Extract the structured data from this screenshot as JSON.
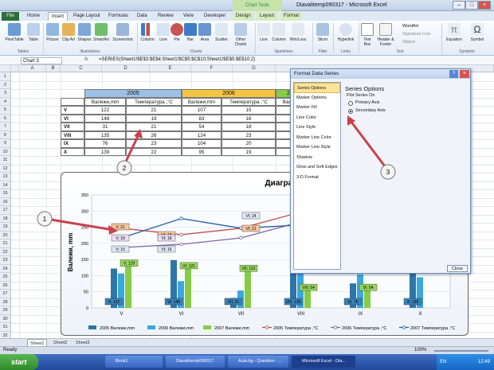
{
  "window": {
    "title": "Diavalitemp090317 - Microsoft Excel",
    "contextual_group": "Chart Tools"
  },
  "tabs": [
    "File",
    "Home",
    "Insert",
    "Page Layout",
    "Formulas",
    "Data",
    "Review",
    "View",
    "Developer",
    "Design",
    "Layout",
    "Format"
  ],
  "ribbon": {
    "buttons": [
      "PivotTable",
      "Table",
      "Picture",
      "Clip Art",
      "Shapes",
      "SmartArt",
      "Screenshot",
      "Column",
      "Line",
      "Pie",
      "Bar",
      "Area",
      "Scatter",
      "Other Charts",
      "Line",
      "Column",
      "Win/Loss",
      "Slicer",
      "Hyperlink",
      "Text Box",
      "Header & Footer",
      "Equation",
      "Symbol"
    ],
    "small": [
      "WordArt",
      "Signature Line",
      "Object"
    ],
    "groups": [
      "Tables",
      "Illustrations",
      "Charts",
      "Sparklines",
      "Filter",
      "Links",
      "Text",
      "Symbols"
    ]
  },
  "formula_bar": {
    "name_box": "Chart 3",
    "fx": "fx",
    "formula": "=SERIES(Sheet1!$E$3:$E$4;Sheet1!$C$5:$C$10;Sheet1!$E$5:$E$10;2)"
  },
  "columns": [
    "A",
    "B",
    "C",
    "D",
    "E",
    "F",
    "G"
  ],
  "rows": [
    "1",
    "2",
    "3",
    "4",
    "5",
    "6",
    "7",
    "8",
    "9",
    "10",
    "11",
    "12",
    "13",
    "14",
    "15",
    "16",
    "17",
    "18",
    "19",
    "20",
    "21",
    "22",
    "23",
    "24",
    "25",
    "26",
    "27",
    "28",
    "29",
    "30",
    "31",
    "32"
  ],
  "table": {
    "years": [
      "2005",
      "2006",
      "2"
    ],
    "headers": [
      "Валежи,mm",
      "Температура ,°C",
      "Валежи,mm",
      "Температура ,°C",
      "Вале"
    ],
    "rows": [
      {
        "month": "V",
        "v1": "122",
        "t1": "21",
        "v2": "107",
        "t2": "15"
      },
      {
        "month": "VI",
        "v1": "148",
        "t1": "19",
        "v2": "83",
        "t2": "16"
      },
      {
        "month": "VII",
        "v1": "31",
        "t1": "21",
        "v2": "54",
        "t2": "18"
      },
      {
        "month": "VIII",
        "v1": "135",
        "t1": "26",
        "v2": "124",
        "t2": "23"
      },
      {
        "month": "IX",
        "v1": "76",
        "t1": "23",
        "v2": "104",
        "t2": "20"
      },
      {
        "month": "X",
        "v1": "139",
        "t1": "22",
        "v2": "95",
        "t2": "19"
      }
    ]
  },
  "chart": {
    "title": "Диаграма валежи и те",
    "ylabel": "Валежи, mm",
    "yticks": [
      "0",
      "50",
      "100",
      "150",
      "200",
      "250",
      "300",
      "350"
    ],
    "categories": [
      "V",
      "VI",
      "VII",
      "VIII",
      "IX",
      "X"
    ],
    "labels_2005": [
      "V; 122",
      "VI; 148",
      "VII; 31",
      "VIII; 135",
      "IX; 76",
      "X; 139"
    ],
    "labels_2006": [
      "",
      "",
      "",
      "",
      "",
      ""
    ],
    "labels_2007": [
      "V; 129",
      "VI; 121",
      "VII; 113",
      "VIII; 54",
      "IX; 54",
      ""
    ],
    "line_labels": [
      "V; 21",
      "VI; 19",
      "V; 18",
      "VI; 18",
      "V; 15",
      "VI; 16",
      "VI; 24",
      "VI; 21"
    ],
    "legend": [
      "2005 Валежи,mm",
      "2006 Валежи,mm",
      "2007 Валежи,mm",
      "2005 Температура ,°C",
      "2006 Температура ,°C",
      "2007 Температура ,°C"
    ],
    "colors": {
      "bar2005": "#2e75a8",
      "bar2006": "#39a8de",
      "bar2007": "#86cc46",
      "line2005": "#c0504d",
      "line2006": "#8064a2",
      "line2007": "#1f5fa8"
    }
  },
  "chart_data": {
    "type": "bar",
    "categories": [
      "V",
      "VI",
      "VII",
      "VIII",
      "IX",
      "X"
    ],
    "series": [
      {
        "name": "2005 Валежи,mm",
        "values": [
          122,
          148,
          31,
          135,
          76,
          139
        ]
      },
      {
        "name": "2006 Валежи,mm",
        "values": [
          107,
          83,
          54,
          124,
          104,
          95
        ]
      },
      {
        "name": "2007 Валежи,mm",
        "values": [
          129,
          121,
          113,
          54,
          54,
          0
        ]
      }
    ],
    "lines": [
      {
        "name": "2005 Температура ,°C",
        "values": [
          21,
          19,
          21,
          26,
          23,
          22
        ]
      },
      {
        "name": "2006 Температура ,°C",
        "values": [
          15,
          16,
          18,
          23,
          20,
          19
        ]
      },
      {
        "name": "2007 Температура ,°C",
        "values": [
          18,
          24,
          21,
          22,
          20,
          18
        ]
      }
    ],
    "ylim": [
      0,
      350
    ]
  },
  "dialog": {
    "title": "Format Data Series",
    "items": [
      "Series Options",
      "Marker Options",
      "Marker Fill",
      "Line Color",
      "Line Style",
      "Marker Line Color",
      "Marker Line Style",
      "Shadow",
      "Glow and Soft Edges",
      "3-D Format"
    ],
    "panel_title": "Series Options",
    "plot_on": "Plot Series On",
    "primary": "Primary Axis",
    "secondary": "Secondary Axis",
    "close": "Close"
  },
  "callouts": [
    "1",
    "2",
    "3"
  ],
  "sheet_tabs": [
    "Sheet1",
    "Sheet2",
    "Sheet3"
  ],
  "status": {
    "ready": "Ready",
    "zoom": "100%"
  },
  "taskbar": {
    "start": "start",
    "items": [
      "Book1",
      "Diavalitemp090317",
      "Aula.bg - Question - ...",
      "Microsoft Excel - Dia..."
    ],
    "lang": "EN",
    "time": "12:49"
  }
}
